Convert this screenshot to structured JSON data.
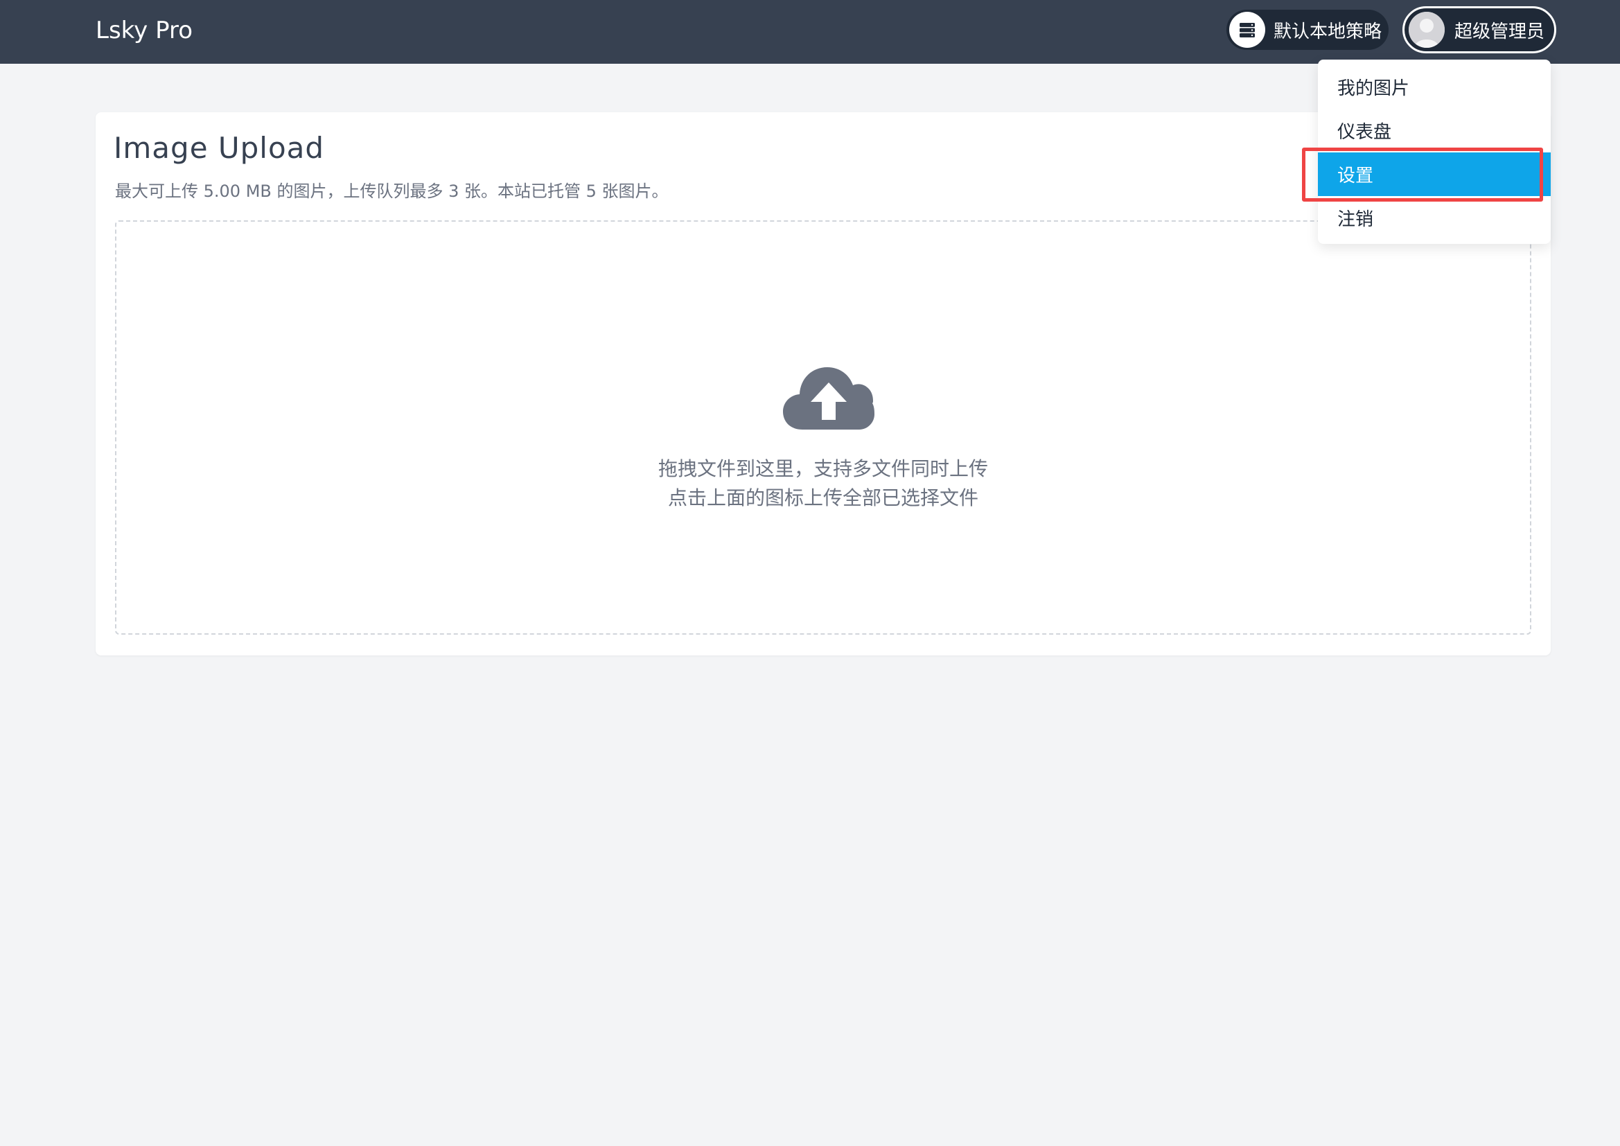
{
  "header": {
    "brand": "Lsky Pro",
    "strategy_label": "默认本地策略",
    "strategy_icon": "server-icon",
    "user_label": "超级管理员",
    "user_icon": "avatar"
  },
  "upload": {
    "title": "Image Upload",
    "subtitle": "最大可上传 5.00 MB 的图片，上传队列最多 3 张。本站已托管 5 张图片。",
    "icon": "cloud-upload-icon",
    "hint_line1": "拖拽文件到这里，支持多文件同时上传",
    "hint_line2": "点击上面的图标上传全部已选择文件"
  },
  "menu": {
    "items": [
      {
        "label": "我的图片"
      },
      {
        "label": "仪表盘"
      },
      {
        "label": "设置",
        "active": true
      },
      {
        "label": "注销"
      }
    ]
  },
  "colors": {
    "header_bg": "#374151",
    "pill_bg": "#1f2937",
    "active_item": "#0ea5e9",
    "highlight": "#ef4444",
    "page_bg": "#f3f4f6"
  }
}
